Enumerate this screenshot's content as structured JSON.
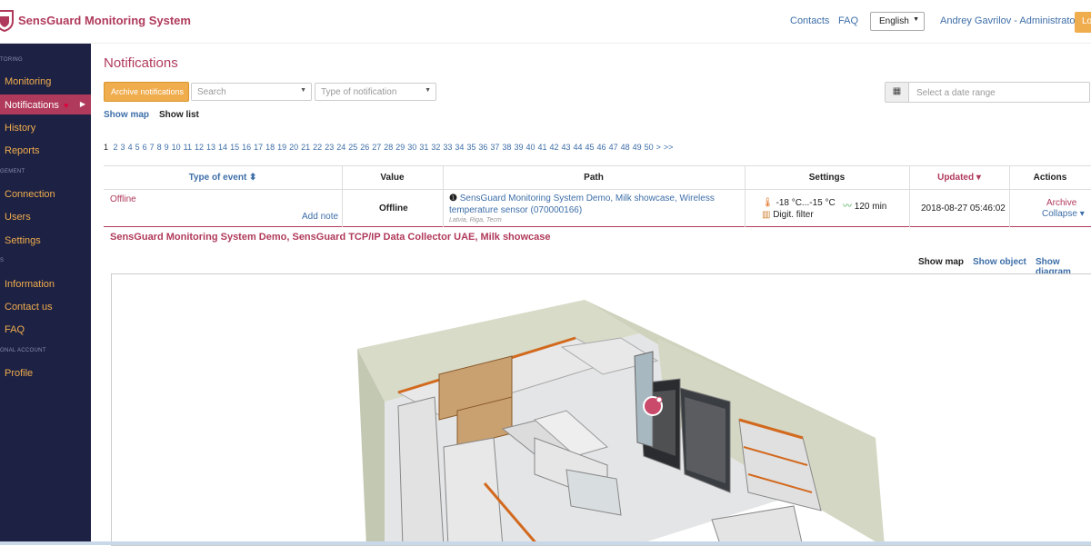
{
  "header": {
    "brand": "SensGuard Monitoring System",
    "contacts": "Contacts",
    "faq": "FAQ",
    "language": "English",
    "user": "Andrey Gavrilov - Administrator",
    "logout": "Log"
  },
  "sidebar": {
    "sections": [
      "TORING",
      "GEMENT",
      "S",
      "ONAL ACCOUNT"
    ],
    "items": [
      {
        "label": "Monitoring"
      },
      {
        "label": "Notifications"
      },
      {
        "label": "History"
      },
      {
        "label": "Reports"
      },
      {
        "label": "Connection"
      },
      {
        "label": "Users"
      },
      {
        "label": "Settings"
      },
      {
        "label": "Information"
      },
      {
        "label": "Contact us"
      },
      {
        "label": "FAQ"
      },
      {
        "label": "Profile"
      }
    ]
  },
  "main": {
    "title": "Notifications",
    "archive_button": "Archive notifications",
    "search_placeholder": "Search",
    "type_placeholder": "Type of notification",
    "date_placeholder": "Select a date range",
    "show_map": "Show map",
    "show_list": "Show list"
  },
  "pagination": {
    "current": "1",
    "pages": [
      "2",
      "3",
      "4",
      "5",
      "6",
      "7",
      "8",
      "9",
      "10",
      "11",
      "12",
      "13",
      "14",
      "15",
      "16",
      "17",
      "18",
      "19",
      "20",
      "21",
      "22",
      "23",
      "24",
      "25",
      "26",
      "27",
      "28",
      "29",
      "30",
      "31",
      "32",
      "33",
      "34",
      "35",
      "36",
      "37",
      "38",
      "39",
      "40",
      "41",
      "42",
      "43",
      "44",
      "45",
      "46",
      "47",
      "48",
      "49",
      "50"
    ],
    "next": ">",
    "last": ">>"
  },
  "table": {
    "headers": {
      "type": "Type of event ⬍",
      "value": "Value",
      "path": "Path",
      "settings": "Settings",
      "updated": "Updated ▾",
      "actions": "Actions"
    },
    "row": {
      "event": "Offline",
      "add_note": "Add note",
      "value": "Offline",
      "path": "SensGuard Monitoring System Demo, Milk showcase, Wireless temperature sensor (070000166)",
      "location": "Latvia, Riga, Tecm",
      "temp_range": "-18 °C...-15 °C",
      "interval": "120 min",
      "filter": "Digit. filter",
      "updated": "2018-08-27 05:46:02",
      "archive": "Archive",
      "collapse": "Collapse ▾"
    }
  },
  "detail": {
    "title": "SensGuard Monitoring System Demo, SensGuard TCP/IP Data Collector UAE, Milk showcase",
    "show_map": "Show map",
    "show_object": "Show object",
    "show_diagram": "Show diagram"
  },
  "colors": {
    "brand": "#b03a5b",
    "accent": "#f0ad4e",
    "sidebar_bg": "#1d2143",
    "link": "#3d6ea8"
  }
}
